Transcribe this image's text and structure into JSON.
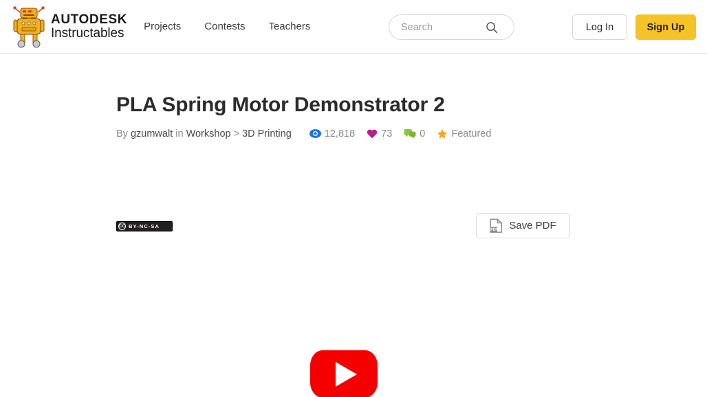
{
  "header": {
    "brand": {
      "line1": "AUTODESK",
      "line2": "Instructables",
      "logo_icon": "instructables-robot-icon"
    },
    "nav": [
      {
        "label": "Projects"
      },
      {
        "label": "Contests"
      },
      {
        "label": "Teachers"
      }
    ],
    "search": {
      "value": "",
      "placeholder": "Search",
      "icon": "search-icon"
    },
    "login_label": "Log In",
    "signup_label": "Sign Up",
    "signup_color": "#f5c227"
  },
  "article": {
    "title": "PLA Spring Motor Demonstrator 2",
    "byline": {
      "by_label": "By",
      "author": "gzumwalt",
      "in_label": "in",
      "category": "Workshop",
      "separator": ">",
      "subcategory": "3D Printing"
    },
    "stats": [
      {
        "icon": "eye-icon",
        "value": "12,818",
        "color": "#1a73e8"
      },
      {
        "icon": "heart-icon",
        "value": "73",
        "color": "#c4168d"
      },
      {
        "icon": "comment-icon",
        "value": "0",
        "color": "#8cc63f"
      },
      {
        "icon": "star-icon",
        "value": "Featured",
        "color": "#f5a623"
      }
    ],
    "license": {
      "cc_label": "CC",
      "terms": "BY-NC-SA"
    },
    "save_pdf": {
      "label": "Save PDF",
      "icon": "pdf-document-icon",
      "icon_label": "PDF"
    },
    "video": {
      "play_icon": "youtube-play-icon",
      "play_color": "#f40000"
    }
  }
}
